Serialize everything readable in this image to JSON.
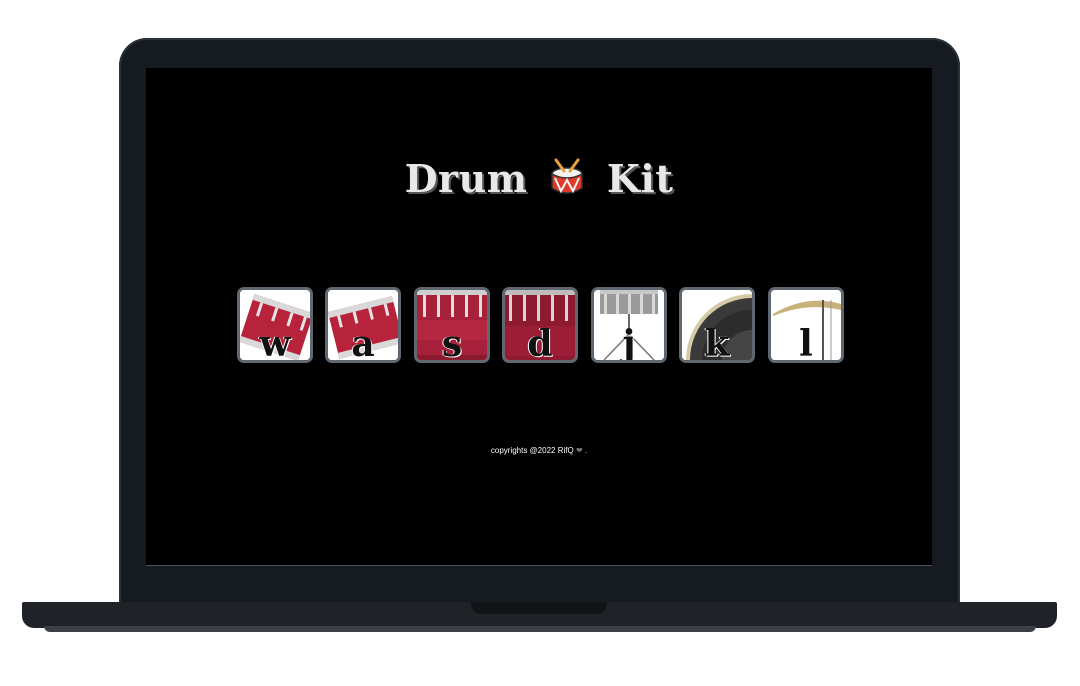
{
  "app": {
    "title_left": "Drum",
    "title_right": "Kit",
    "title_icon": "drum-icon"
  },
  "pads": [
    {
      "key": "w",
      "icon": "tom-drum-tilted-icon"
    },
    {
      "key": "a",
      "icon": "tom-drum-tilted-icon"
    },
    {
      "key": "s",
      "icon": "snare-drum-icon"
    },
    {
      "key": "d",
      "icon": "bass-drum-icon"
    },
    {
      "key": "j",
      "icon": "snare-stand-icon"
    },
    {
      "key": "k",
      "icon": "crash-cymbal-icon"
    },
    {
      "key": "l",
      "icon": "hi-hat-cymbal-icon"
    }
  ],
  "footer": {
    "text": "copyrights @2022 RifQ",
    "heart": "❤",
    "suffix": "."
  },
  "colors": {
    "screen_bg": "#000000",
    "pad_border": "#5f6770",
    "drum_red": "#b8233c",
    "title_text": "#e8e8e8"
  }
}
